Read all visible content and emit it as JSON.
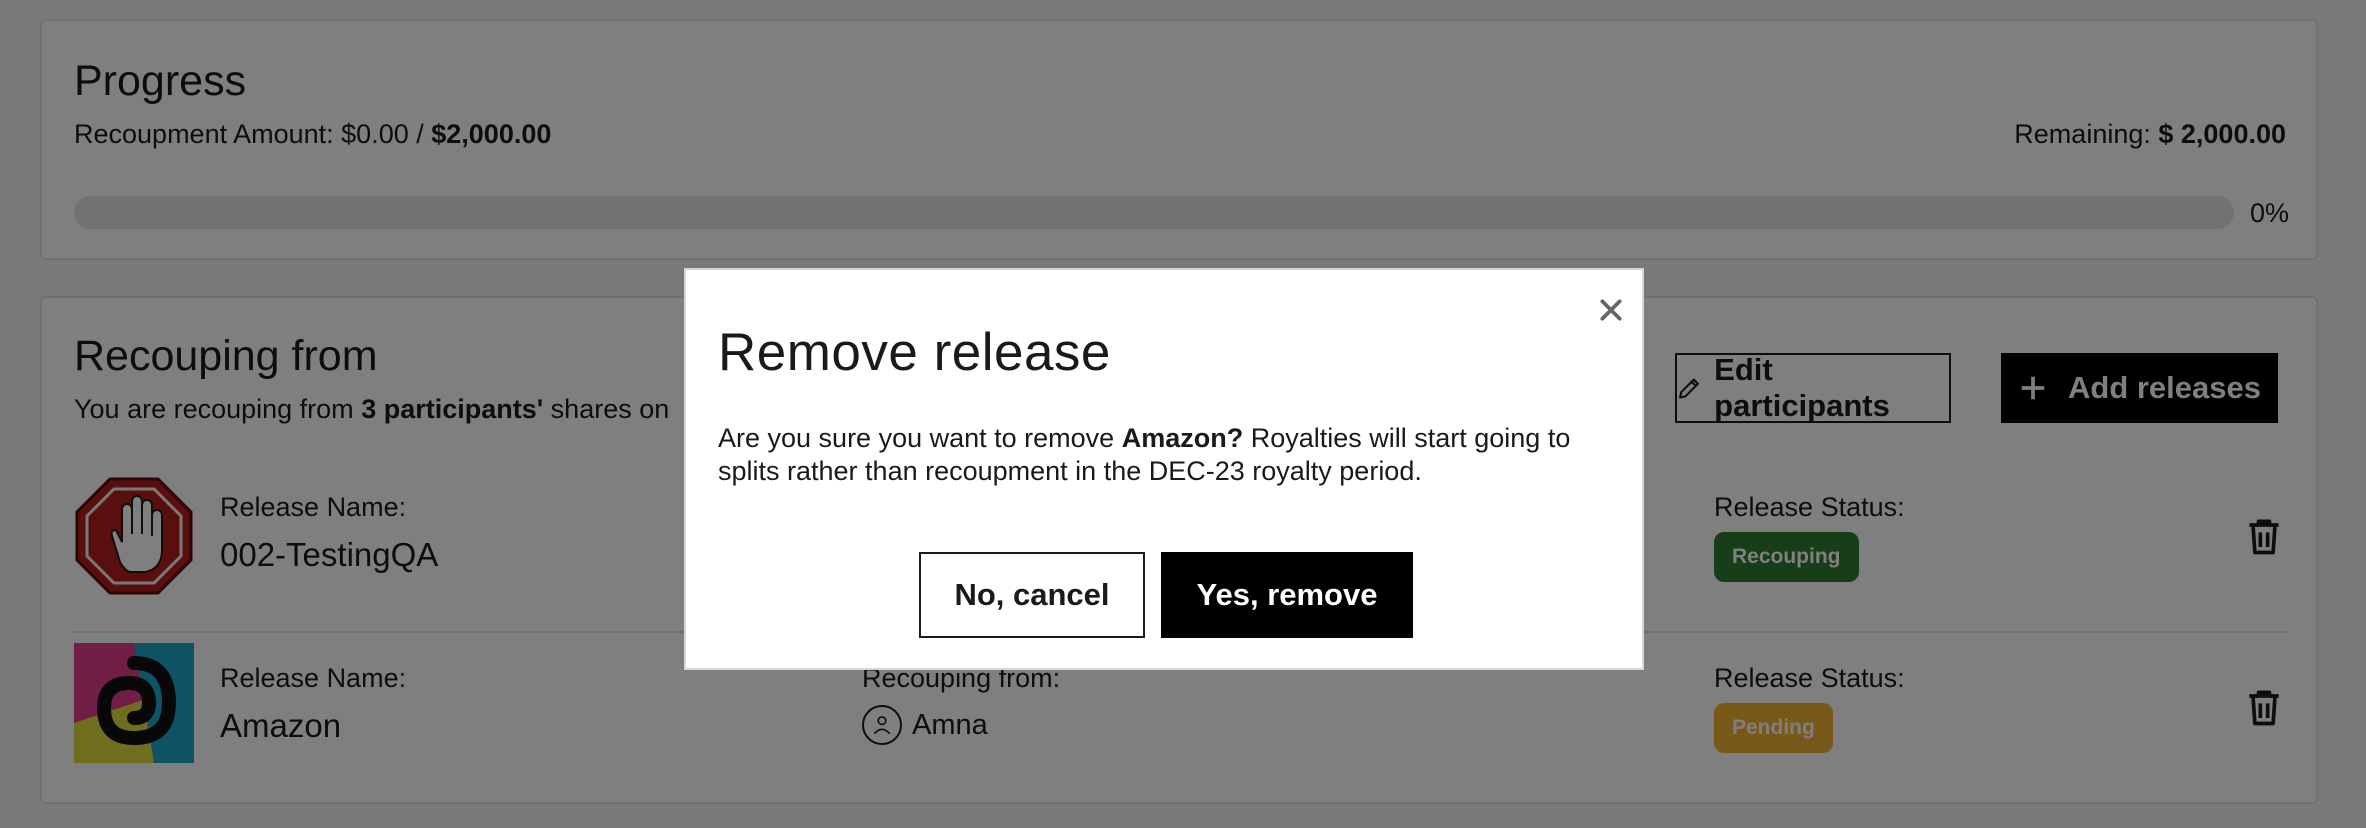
{
  "progress": {
    "title": "Progress",
    "amount_label": "Recoupment Amount: ",
    "amount_current": "$0.00",
    "amount_sep": " / ",
    "amount_total": "$2,000.00",
    "remaining_label": "Remaining: ",
    "remaining_value": "$ 2,000.00",
    "percent": "0%",
    "fraction": 0
  },
  "recouping": {
    "title": "Recouping from",
    "subtitle_prefix": "You are recouping from ",
    "subtitle_bold": "3 participants'",
    "subtitle_suffix": " shares on",
    "edit_label": "Edit participants",
    "add_label": "Add releases",
    "releases": [
      {
        "name_label": "Release Name:",
        "name": "002-TestingQA",
        "status_label": "Release Status:",
        "status": "Recouping",
        "status_color": "#2e7d32",
        "thumb_icon": "stop-hand-icon"
      },
      {
        "name_label": "Release Name:",
        "name": "Amazon",
        "from_label": "Recouping from:",
        "participant": "Amna",
        "status_label": "Release Status:",
        "status": "Pending",
        "status_color": "#f2b233",
        "thumb_icon": "spiral-art-icon"
      }
    ]
  },
  "modal": {
    "title": "Remove release",
    "body_prefix": "Are you sure you want to remove ",
    "body_bold": "Amazon?",
    "body_suffix": " Royalties will start going to splits rather than recoupment in the DEC-23 royalty period.",
    "cancel_label": "No, cancel",
    "confirm_label": "Yes, remove"
  }
}
